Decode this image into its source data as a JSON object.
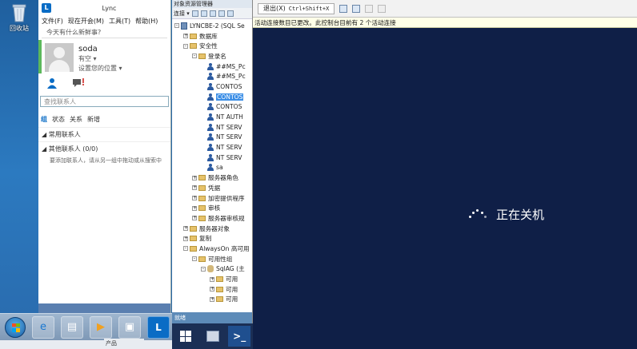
{
  "desktop": {
    "recycle_bin_label": "回收站"
  },
  "lync": {
    "app_title": "Lync",
    "menu": [
      "文件(F)",
      "现在开会(M)",
      "工具(T)",
      "帮助(H)"
    ],
    "mood_prompt": "今天有什么新鲜事?",
    "user_name": "soda",
    "status": "有空 ▾",
    "location": "设置您的位置 ▾",
    "search_placeholder": "查找联系人",
    "tabs": [
      "组",
      "状态",
      "关系",
      "新增"
    ],
    "group_frequent": "◢ 常用联系人",
    "group_other": "◢ 其他联系人 (0/0)",
    "empty_hint": "要添加联系人，请从另一组中拖动或从搜索中",
    "colors": {
      "accent": "#0a6cc5",
      "presence": "#5cb85c"
    }
  },
  "ssms": {
    "pane_title": "对象资源管理器",
    "toolbar_connect": "连接 ▾",
    "tree": [
      {
        "level": 0,
        "expander": "-",
        "icon": "server",
        "text": "LYNCBE-2 (SQL Se"
      },
      {
        "level": 1,
        "expander": "+",
        "icon": "folder",
        "text": "数据库"
      },
      {
        "level": 1,
        "expander": "-",
        "icon": "folder",
        "text": "安全性"
      },
      {
        "level": 2,
        "expander": "-",
        "icon": "folder",
        "text": "登录名"
      },
      {
        "level": 3,
        "expander": "",
        "icon": "user",
        "text": "##MS_Pc"
      },
      {
        "level": 3,
        "expander": "",
        "icon": "user",
        "text": "##MS_Pc"
      },
      {
        "level": 3,
        "expander": "",
        "icon": "user",
        "text": "CONTOS"
      },
      {
        "level": 3,
        "expander": "",
        "icon": "user",
        "text": "CONTOS",
        "selected": true
      },
      {
        "level": 3,
        "expander": "",
        "icon": "user",
        "text": "CONTOS"
      },
      {
        "level": 3,
        "expander": "",
        "icon": "user",
        "text": "NT AUTH"
      },
      {
        "level": 3,
        "expander": "",
        "icon": "user",
        "text": "NT SERV"
      },
      {
        "level": 3,
        "expander": "",
        "icon": "user",
        "text": "NT SERV"
      },
      {
        "level": 3,
        "expander": "",
        "icon": "user",
        "text": "NT SERV"
      },
      {
        "level": 3,
        "expander": "",
        "icon": "user",
        "text": "NT SERV"
      },
      {
        "level": 3,
        "expander": "",
        "icon": "user",
        "text": "sa"
      },
      {
        "level": 2,
        "expander": "+",
        "icon": "folder",
        "text": "服务器角色"
      },
      {
        "level": 2,
        "expander": "+",
        "icon": "folder",
        "text": "凭据"
      },
      {
        "level": 2,
        "expander": "+",
        "icon": "folder",
        "text": "加密提供程序"
      },
      {
        "level": 2,
        "expander": "+",
        "icon": "folder",
        "text": "审核"
      },
      {
        "level": 2,
        "expander": "+",
        "icon": "folder",
        "text": "服务器审核规"
      },
      {
        "level": 1,
        "expander": "+",
        "icon": "folder",
        "text": "服务器对象"
      },
      {
        "level": 1,
        "expander": "+",
        "icon": "folder",
        "text": "复制"
      },
      {
        "level": 1,
        "expander": "-",
        "icon": "folder",
        "text": "AlwaysOn 高可用"
      },
      {
        "level": 2,
        "expander": "-",
        "icon": "folder",
        "text": "可用性组"
      },
      {
        "level": 3,
        "expander": "-",
        "icon": "db",
        "text": "SqlAG (主"
      },
      {
        "level": 4,
        "expander": "+",
        "icon": "folder",
        "text": "可用"
      },
      {
        "level": 4,
        "expander": "+",
        "icon": "folder",
        "text": "可用"
      },
      {
        "level": 4,
        "expander": "+",
        "icon": "folder",
        "text": "可用"
      }
    ],
    "status": "就绪"
  },
  "remote": {
    "logout_label": "退出(X)",
    "logout_shortcut": "Ctrl+Shift+X",
    "notice": "活动连接数目已更改。此控制台目前有 2 个活动连接",
    "shutdown_message": "正在关机",
    "colors": {
      "background": "#0f1f47"
    }
  },
  "taskbar": {
    "apps": [
      "start-orb",
      "ie",
      "explorer",
      "media-player",
      "remote-desktop",
      "lync"
    ],
    "product_label": "产品"
  }
}
